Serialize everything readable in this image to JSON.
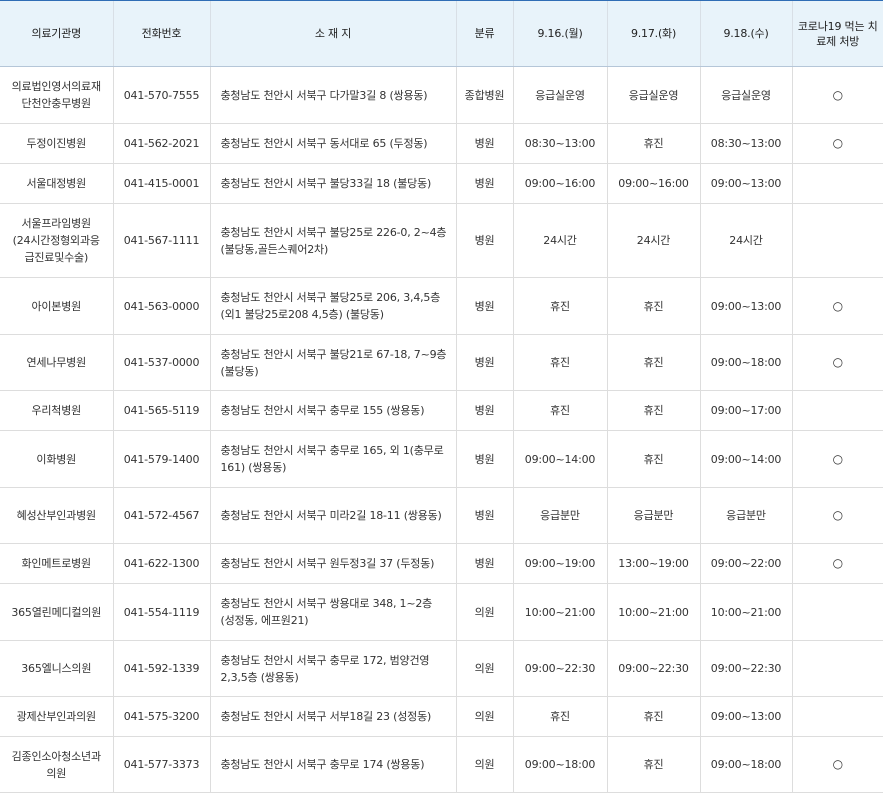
{
  "table": {
    "headers": [
      "의료기관명",
      "전화번호",
      "소 재 지",
      "분류",
      "9.16.(월)",
      "9.17.(화)",
      "9.18.(수)",
      "코로나19 먹는 치료제 처방"
    ],
    "rows": [
      {
        "name": "의료법인영서의료재단천안충무병원",
        "phone": "041-570-7555",
        "address": "충청남도 천안시 서북구 다가말3길 8 (쌍용동)",
        "category": "종합병원",
        "d1": "응급실운영",
        "d2": "응급실운영",
        "d3": "응급실운영",
        "covid": "○"
      },
      {
        "name": "두정이진병원",
        "phone": "041-562-2021",
        "address": "충청남도 천안시 서북구 동서대로 65 (두정동)",
        "category": "병원",
        "d1": "08:30~13:00",
        "d2": "휴진",
        "d3": "08:30~13:00",
        "covid": "○"
      },
      {
        "name": "서울대정병원",
        "phone": "041-415-0001",
        "address": "충청남도 천안시 서북구 불당33길 18 (불당동)",
        "category": "병원",
        "d1": "09:00~16:00",
        "d2": "09:00~16:00",
        "d3": "09:00~13:00",
        "covid": ""
      },
      {
        "name": "서울프라임병원(24시간정형외과응급진료및수술)",
        "phone": "041-567-1111",
        "address": "충청남도 천안시 서북구 불당25로 226-0, 2~4층 (불당동,골든스퀘어2차)",
        "category": "병원",
        "d1": "24시간",
        "d2": "24시간",
        "d3": "24시간",
        "covid": ""
      },
      {
        "name": "아이본병원",
        "phone": "041-563-0000",
        "address": "충청남도 천안시 서북구 불당25로 206, 3,4,5층(외1 불당25로208 4,5층) (불당동)",
        "category": "병원",
        "d1": "휴진",
        "d2": "휴진",
        "d3": "09:00~13:00",
        "covid": "○"
      },
      {
        "name": "연세나무병원",
        "phone": "041-537-0000",
        "address": "충청남도 천안시 서북구 불당21로 67-18, 7~9층 (불당동)",
        "category": "병원",
        "d1": "휴진",
        "d2": "휴진",
        "d3": "09:00~18:00",
        "covid": "○"
      },
      {
        "name": "우리척병원",
        "phone": "041-565-5119",
        "address": "충청남도 천안시 서북구 충무로 155 (쌍용동)",
        "category": "병원",
        "d1": "휴진",
        "d2": "휴진",
        "d3": "09:00~17:00",
        "covid": ""
      },
      {
        "name": "이화병원",
        "phone": "041-579-1400",
        "address": "충청남도 천안시 서북구 충무로 165, 외 1(충무로 161) (쌍용동)",
        "category": "병원",
        "d1": "09:00~14:00",
        "d2": "휴진",
        "d3": "09:00~14:00",
        "covid": "○"
      },
      {
        "name": "혜성산부인과병원",
        "phone": "041-572-4567",
        "address": "충청남도 천안시 서북구 미라2길 18-11 (쌍용동)",
        "category": "병원",
        "d1": "응급분만",
        "d2": "응급분만",
        "d3": "응급분만",
        "covid": "○"
      },
      {
        "name": "화인메트로병원",
        "phone": "041-622-1300",
        "address": "충청남도 천안시 서북구 원두정3길 37 (두정동)",
        "category": "병원",
        "d1": "09:00~19:00",
        "d2": "13:00~19:00",
        "d3": "09:00~22:00",
        "covid": "○"
      },
      {
        "name": "365열린메디컬의원",
        "phone": "041-554-1119",
        "address": "충청남도 천안시 서북구 쌍용대로 348, 1~2층 (성정동, 에프원21)",
        "category": "의원",
        "d1": "10:00~21:00",
        "d2": "10:00~21:00",
        "d3": "10:00~21:00",
        "covid": ""
      },
      {
        "name": "365엘니스의원",
        "phone": "041-592-1339",
        "address": "충청남도 천안시 서북구 충무로 172, 범양건영 2,3,5층 (쌍용동)",
        "category": "의원",
        "d1": "09:00~22:30",
        "d2": "09:00~22:30",
        "d3": "09:00~22:30",
        "covid": ""
      },
      {
        "name": "광제산부인과의원",
        "phone": "041-575-3200",
        "address": "충청남도 천안시 서북구 서부18길 23 (성정동)",
        "category": "의원",
        "d1": "휴진",
        "d2": "휴진",
        "d3": "09:00~13:00",
        "covid": ""
      },
      {
        "name": "김종인소아청소년과의원",
        "phone": "041-577-3373",
        "address": "충청남도 천안시 서북구 충무로 174 (쌍용동)",
        "category": "의원",
        "d1": "09:00~18:00",
        "d2": "휴진",
        "d3": "09:00~18:00",
        "covid": "○"
      }
    ]
  }
}
